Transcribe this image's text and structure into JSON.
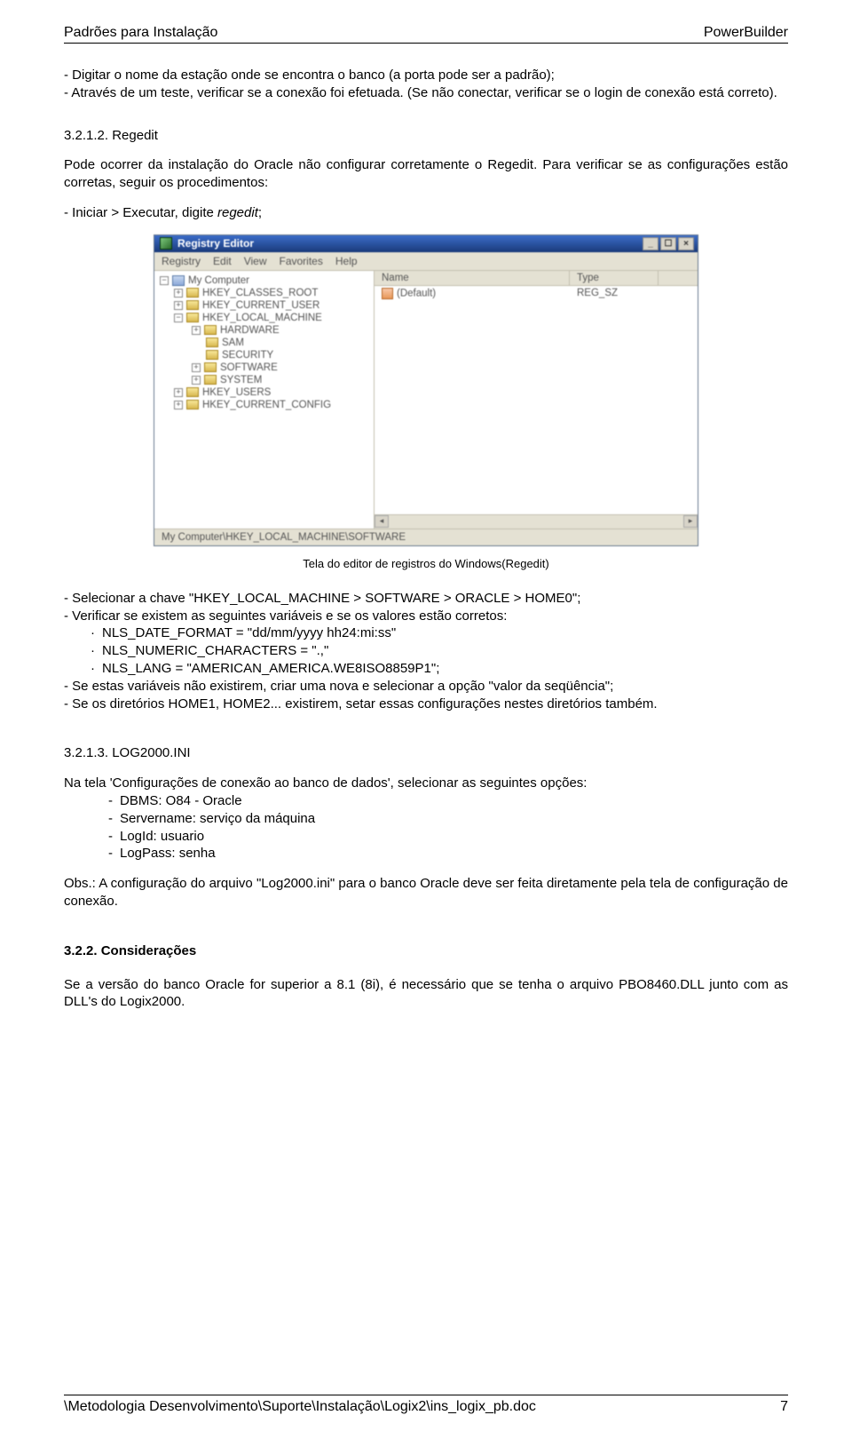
{
  "header": {
    "left": "Padrões para Instalação",
    "right": "PowerBuilder"
  },
  "intro": {
    "line1_prefix": "- Digitar o nome da estação onde se encontra o banco (a porta pode ser a padrão);",
    "line2": "- Através de um teste, verificar se a conexão foi efetuada. (Se não conectar, verificar se o login de conexão está correto)."
  },
  "sec_3212": {
    "title": "3.2.1.2. Regedit",
    "para": "Pode ocorrer da instalação do Oracle não configurar corretamente o Regedit. Para verificar se as configurações estão corretas, seguir os procedimentos:",
    "step_prefix": "- Iniciar > Executar, digite ",
    "step_cmd": "regedit",
    "step_suffix": ";"
  },
  "regedit": {
    "title": "Registry Editor",
    "menu": [
      "Registry",
      "Edit",
      "View",
      "Favorites",
      "Help"
    ],
    "tree_root": "My Computer",
    "tree_top": [
      "HKEY_CLASSES_ROOT",
      "HKEY_CURRENT_USER",
      "HKEY_LOCAL_MACHINE"
    ],
    "tree_sub": [
      "HARDWARE",
      "SAM",
      "SECURITY",
      "SOFTWARE",
      "SYSTEM"
    ],
    "tree_bottom": [
      "HKEY_USERS",
      "HKEY_CURRENT_CONFIG"
    ],
    "col_name": "Name",
    "col_type": "Type",
    "row_name": "(Default)",
    "row_type": "REG_SZ",
    "status": "My Computer\\HKEY_LOCAL_MACHINE\\SOFTWARE"
  },
  "caption": "Tela do editor de registros do Windows(Regedit)",
  "after_regedit": {
    "b1": "- Selecionar a chave \"HKEY_LOCAL_MACHINE > SOFTWARE > ORACLE > HOME0\";",
    "b2": "- Verificar se existem as seguintes variáveis e se os valores estão corretos:",
    "v1": "NLS_DATE_FORMAT = \"dd/mm/yyyy hh24:mi:ss\"",
    "v2": "NLS_NUMERIC_CHARACTERS = \".,\"",
    "v3": "NLS_LANG = \"AMERICAN_AMERICA.WE8ISO8859P1\";",
    "b3": "- Se estas variáveis não existirem, criar uma nova e selecionar a opção \"valor da seqüência\";",
    "b4": "- Se os diretórios HOME1, HOME2... existirem, setar essas configurações nestes diretórios também."
  },
  "sec_3213": {
    "title": "3.2.1.3. LOG2000.INI",
    "intro": "Na tela 'Configurações de conexão ao banco de dados', selecionar as seguintes opções:",
    "items": [
      "DBMS: O84 - Oracle",
      "Servername: serviço da máquina",
      "LogId: usuario",
      "LogPass: senha"
    ],
    "obs": "Obs.: A configuração do arquivo \"Log2000.ini\" para o banco Oracle deve ser feita diretamente pela tela de configuração de conexão."
  },
  "sec_322": {
    "title": "3.2.2. Considerações",
    "para": "Se a versão do banco Oracle for superior a 8.1 (8i), é necessário que se tenha o arquivo PBO8460.DLL junto com as DLL's do Logix2000."
  },
  "footer": {
    "path": "\\Metodologia Desenvolvimento\\Suporte\\Instalação\\Logix2\\ins_logix_pb.doc",
    "page": "7"
  }
}
